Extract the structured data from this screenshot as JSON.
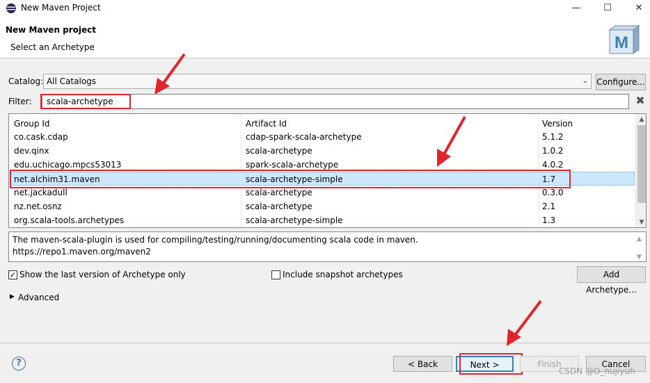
{
  "window": {
    "title": "New Maven Project",
    "minimize": "—",
    "maximize": "☐",
    "close": "✕"
  },
  "header": {
    "title": "New Maven project",
    "subtitle": "Select an Archetype",
    "logo_letter": "M"
  },
  "catalog": {
    "label": "Catalog:",
    "value": "All Catalogs",
    "configure_label": "Configure..."
  },
  "filter": {
    "label": "Filter:",
    "value": "scala-archetype"
  },
  "table": {
    "headers": [
      "Group Id",
      "Artifact Id",
      "Version"
    ],
    "rows": [
      {
        "group": "co.cask.cdap",
        "artifact": "cdap-spark-scala-archetype",
        "version": "5.1.2"
      },
      {
        "group": "dev.qinx",
        "artifact": "scala-archetype",
        "version": "1.0.2"
      },
      {
        "group": "edu.uchicago.mpcs53013",
        "artifact": "spark-scala-archetype",
        "version": "4.0.2"
      },
      {
        "group": "net.alchim31.maven",
        "artifact": "scala-archetype-simple",
        "version": "1.7"
      },
      {
        "group": "net.jackadull",
        "artifact": "scala-archetype",
        "version": "0.3.0"
      },
      {
        "group": "nz.net.osnz",
        "artifact": "scala-archetype",
        "version": "2.1"
      },
      {
        "group": "org.scala-tools.archetypes",
        "artifact": "scala-archetype-simple",
        "version": "1.3"
      }
    ],
    "selected_index": 3
  },
  "description": {
    "line1": "The maven-scala-plugin is used for compiling/testing/running/documenting scala code in maven.",
    "line2": "https://repo1.maven.org/maven2"
  },
  "options": {
    "last_version_label": "Show the last version of Archetype only",
    "last_version_checked": true,
    "snapshot_label": "Include snapshot archetypes",
    "snapshot_checked": false,
    "add_archetype_label": "Add Archetype...",
    "advanced_label": "Advanced"
  },
  "buttons": {
    "back": "< Back",
    "next": "Next >",
    "finish": "Finish",
    "cancel": "Cancel",
    "help": "?"
  },
  "watermark": "CSDN @O_nujiyuh",
  "colors": {
    "selection": "#cce8ff",
    "annotation_red": "#e0262c",
    "accent_blue": "#3c7fb1"
  }
}
